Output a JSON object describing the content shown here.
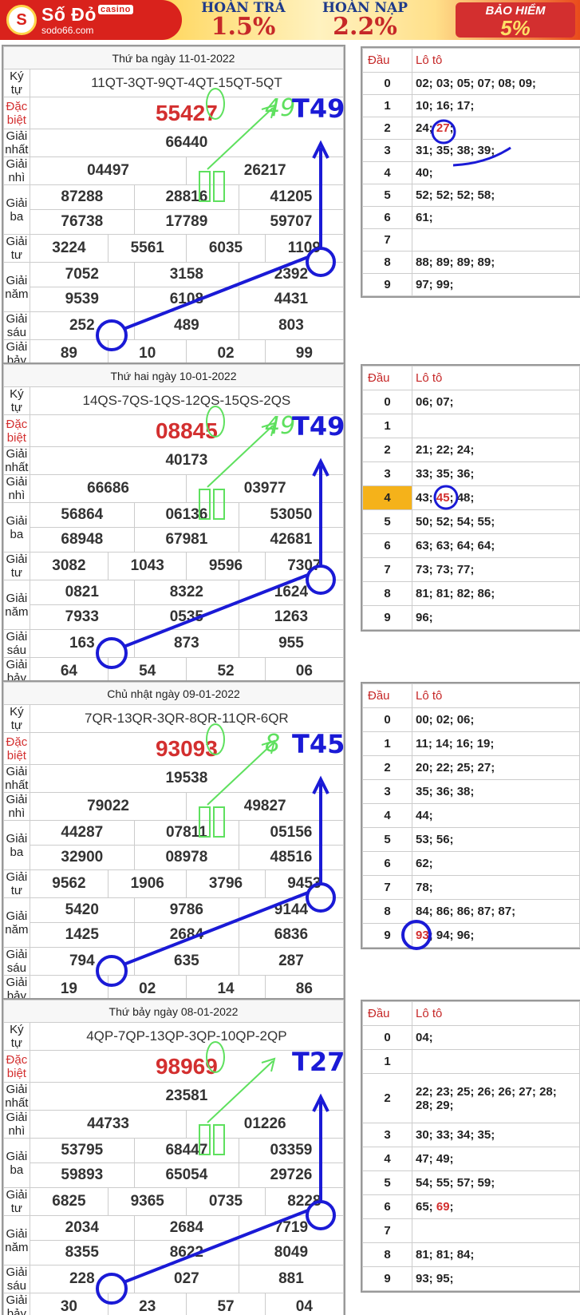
{
  "banner": {
    "logo_main": "Số Đỏ",
    "logo_casino": "casino",
    "logo_site": "sodo66.com",
    "promo1_title": "HOÀN TRẢ",
    "promo1_value": "1.5%",
    "promo2_title": "HOÀN NẠP",
    "promo2_value": "2.2%",
    "insurance_title": "BẢO HIỂM",
    "insurance_value": "5%"
  },
  "labels": {
    "ky_tu": "Ký tự",
    "dac_biet": "Đặc biệt",
    "giai_nhat": "Giải nhất",
    "giai_nhi": "Giải nhì",
    "giai_ba": "Giải ba",
    "giai_tu": "Giải tư",
    "giai_nam": "Giải năm",
    "giai_sau": "Giải sáu",
    "giai_bay": "Giải bảy",
    "dau": "Đầu",
    "loto": "Lô tô"
  },
  "draws": [
    {
      "date": "Thứ ba ngày 11-01-2022",
      "ky_tu": "11QT-3QT-9QT-4QT-15QT-5QT",
      "dac_biet": "55427",
      "nhat": "66440",
      "nhi": [
        "04497",
        "26217"
      ],
      "ba": [
        "87288",
        "28816",
        "41205",
        "76738",
        "17789",
        "59707"
      ],
      "tu": [
        "3224",
        "5561",
        "6035",
        "1109"
      ],
      "nam": [
        "7052",
        "3158",
        "2392",
        "9539",
        "6108",
        "4431"
      ],
      "sau": [
        "252",
        "489",
        "803"
      ],
      "bay": [
        "89",
        "10",
        "02",
        "99"
      ],
      "note": "T49",
      "note_green": "49",
      "loto": [
        "02; 03; 05; 07; 08; 09;",
        "10; 16; 17;",
        "24; 27;",
        "31; 35; 38; 39;",
        "40;",
        "52; 52; 52; 58;",
        "61;",
        "",
        "88; 89; 89; 89;",
        "97; 99;"
      ]
    },
    {
      "date": "Thứ hai ngày 10-01-2022",
      "ky_tu": "14QS-7QS-1QS-12QS-15QS-2QS",
      "dac_biet": "08845",
      "nhat": "40173",
      "nhi": [
        "66686",
        "03977"
      ],
      "ba": [
        "56864",
        "06136",
        "53050",
        "68948",
        "67981",
        "42681"
      ],
      "tu": [
        "3082",
        "1043",
        "9596",
        "7307"
      ],
      "nam": [
        "0821",
        "8322",
        "1624",
        "7933",
        "0535",
        "1263"
      ],
      "sau": [
        "163",
        "873",
        "955"
      ],
      "bay": [
        "64",
        "54",
        "52",
        "06"
      ],
      "note": "T49",
      "note_green": "49",
      "loto": [
        "06; 07;",
        "",
        "21; 22; 24;",
        "33; 35; 36;",
        "43; 45; 48;",
        "50; 52; 54; 55;",
        "63; 63; 64; 64;",
        "73; 73; 77;",
        "81; 81; 82; 86;",
        "96;"
      ]
    },
    {
      "date": "Chủ nhật ngày 09-01-2022",
      "ky_tu": "7QR-13QR-3QR-8QR-11QR-6QR",
      "dac_biet": "93093",
      "nhat": "19538",
      "nhi": [
        "79022",
        "49827"
      ],
      "ba": [
        "44287",
        "07811",
        "05156",
        "32900",
        "08978",
        "48516"
      ],
      "tu": [
        "9562",
        "1906",
        "3796",
        "9453"
      ],
      "nam": [
        "5420",
        "9786",
        "9144",
        "1425",
        "2684",
        "6836"
      ],
      "sau": [
        "794",
        "635",
        "287"
      ],
      "bay": [
        "19",
        "02",
        "14",
        "86"
      ],
      "note": "T45",
      "note_green": "8",
      "loto": [
        "00; 02; 06;",
        "11; 14; 16; 19;",
        "20; 22; 25; 27;",
        "35; 36; 38;",
        "44;",
        "53; 56;",
        "62;",
        "78;",
        "84; 86; 86; 87; 87;",
        "93; 94; 96;"
      ]
    },
    {
      "date": "Thứ bảy ngày 08-01-2022",
      "ky_tu": "4QP-7QP-13QP-3QP-10QP-2QP",
      "dac_biet": "98969",
      "nhat": "23581",
      "nhi": [
        "44733",
        "01226"
      ],
      "ba": [
        "53795",
        "68447",
        "03359",
        "59893",
        "65054",
        "29726"
      ],
      "tu": [
        "6825",
        "9365",
        "0735",
        "8228"
      ],
      "nam": [
        "2034",
        "2684",
        "7719",
        "8355",
        "8622",
        "8049"
      ],
      "sau": [
        "228",
        "027",
        "881"
      ],
      "bay": [
        "30",
        "23",
        "57",
        "04"
      ],
      "note": "T27",
      "note_green": "",
      "loto": [
        "04;",
        "",
        "22; 23; 25; 26; 26; 27; 28; 28; 29;",
        "30; 33; 34; 35;",
        "47; 49;",
        "54; 55; 57; 59;",
        "65; 69;",
        "",
        "81; 81; 84;",
        "93; 95;"
      ]
    }
  ],
  "colors": {
    "red": "#d32f2f",
    "blue": "#1a1ad6",
    "green": "#5ee05e",
    "highlight": "#f5b21a"
  }
}
